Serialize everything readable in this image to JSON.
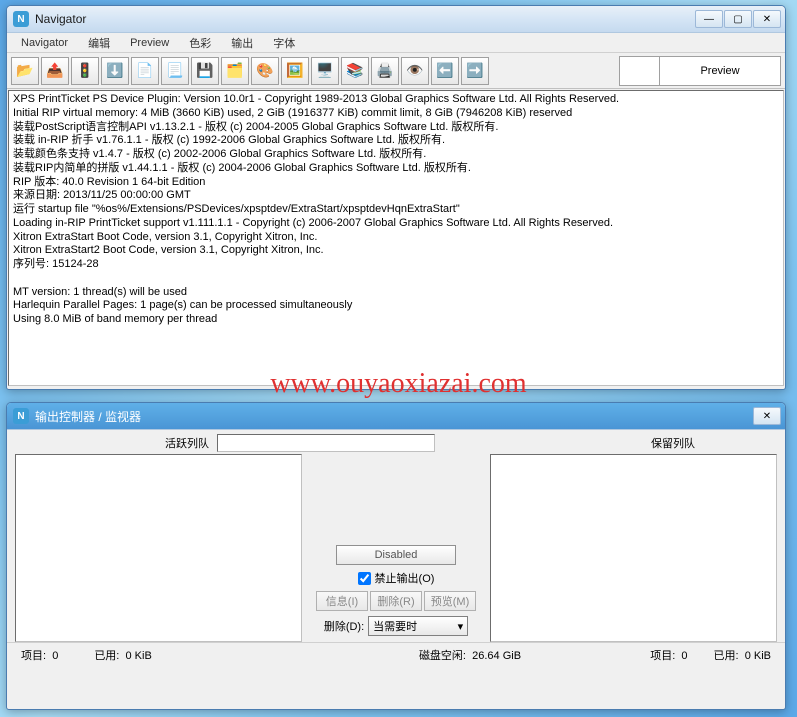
{
  "watermark": "www.ouyaoxiazai.com",
  "window1": {
    "title": "Navigator",
    "menu": [
      "Navigator",
      "编辑",
      "Preview",
      "色彩",
      "输出",
      "字体"
    ],
    "preview_label": "Preview",
    "toolbar_icons": [
      "open-icon",
      "unload-icon",
      "traffic-icon",
      "stop-icon",
      "doc-icon",
      "page-icon",
      "save-icon",
      "separation-icon",
      "color-icon",
      "scan-icon",
      "screen-icon",
      "pages-icon",
      "output-icon",
      "view-icon",
      "arrow-left-icon",
      "arrow-right-icon"
    ],
    "log_lines": [
      "XPS PrintTicket PS Device Plugin: Version 10.0r1 - Copyright 1989-2013 Global Graphics Software Ltd. All Rights Reserved.",
      "Initial RIP virtual memory: 4 MiB (3660 KiB) used, 2 GiB (1916377 KiB) commit limit, 8 GiB (7946208 KiB) reserved",
      "装载PostScript语言控制API v1.13.2.1 - 版权 (c) 2004-2005 Global Graphics Software Ltd. 版权所有.",
      "装载 in-RIP 折手 v1.76.1.1 - 版权 (c) 1992-2006 Global Graphics Software Ltd. 版权所有.",
      "装载颜色条支持 v1.4.7 - 版权 (c) 2002-2006 Global Graphics Software Ltd. 版权所有.",
      "装载RIP内简单的拼版 v1.44.1.1 - 版权 (c) 2004-2006 Global Graphics Software Ltd. 版权所有.",
      "RIP 版本: 40.0 Revision 1 64-bit Edition",
      "来源日期: 2013/11/25 00:00:00 GMT",
      "运行 startup file \"%os%/Extensions/PSDevices/xpsptdev/ExtraStart/xpsptdevHqnExtraStart\"",
      "Loading in-RIP PrintTicket support v1.111.1.1 - Copyright (c) 2006-2007 Global Graphics Software Ltd. All Rights Reserved.",
      "Xitron ExtraStart Boot Code, version 3.1, Copyright Xitron, Inc.",
      "Xitron ExtraStart2 Boot Code, version 3.1, Copyright Xitron, Inc.",
      "序列号: 15124-28",
      "",
      "MT version: 1 thread(s) will be used",
      "Harlequin Parallel Pages: 1 page(s) can be processed simultaneously",
      "Using 8.0 MiB of band memory per thread"
    ]
  },
  "window2": {
    "title": "输出控制器 / 监视器",
    "active_queue_label": "活跃列队",
    "reserve_queue_label": "保留列队",
    "disabled_label": "Disabled",
    "disable_output_label": "禁止输出(O)",
    "disable_output_checked": true,
    "info_btn": "信息(I)",
    "delete_btn": "删除(R)",
    "preview_btn": "预览(M)",
    "delete_label": "删除(D):",
    "delete_select": "当需要时",
    "status": {
      "items_label": "项目:",
      "items_left": "0",
      "used_label": "已用:",
      "used_left": "0 KiB",
      "disk_label": "磁盘空闲:",
      "disk_value": "26.64 GiB",
      "items_right": "0",
      "used_right": "0 KiB"
    }
  }
}
